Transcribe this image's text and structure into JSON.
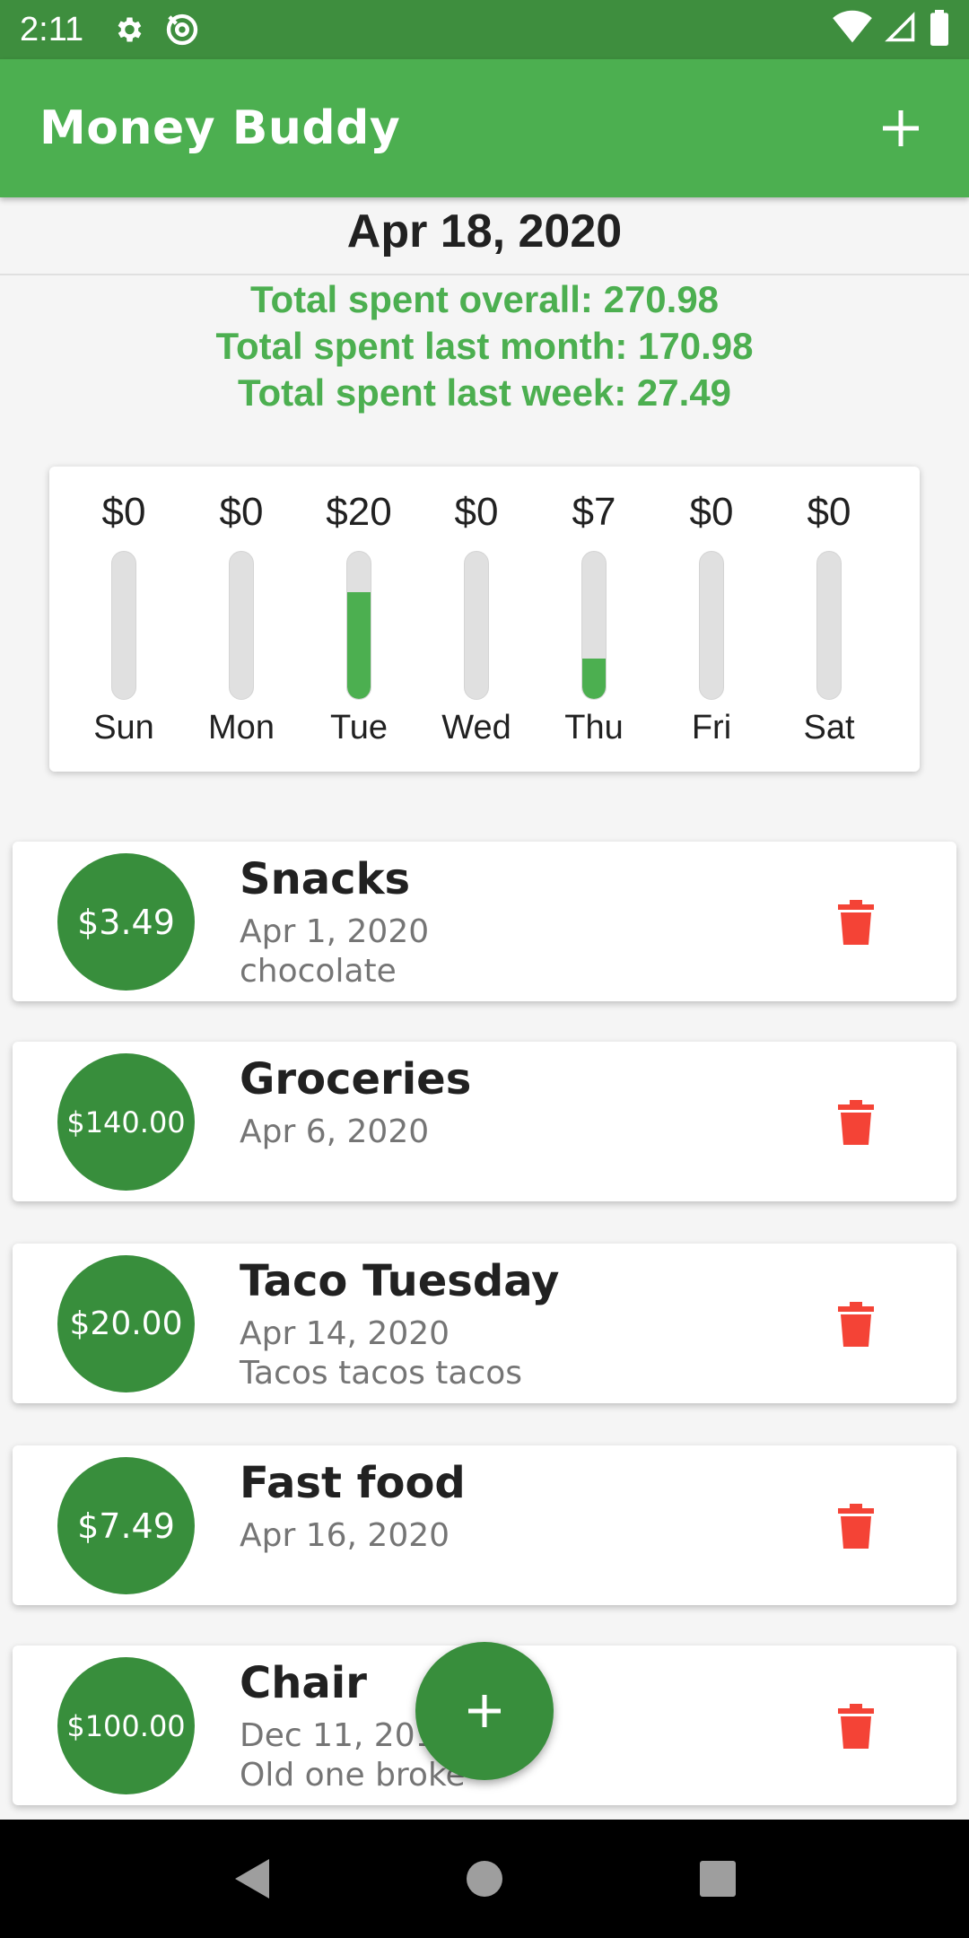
{
  "status_bar": {
    "time": "2:11"
  },
  "app_bar": {
    "title": "Money Buddy"
  },
  "date_heading": "Apr 18, 2020",
  "totals": {
    "overall": "Total spent overall: 270.98",
    "last_month": "Total spent last month: 170.98",
    "last_week": "Total spent last week: 27.49"
  },
  "chart_data": {
    "type": "bar",
    "categories": [
      "Sun",
      "Mon",
      "Tue",
      "Wed",
      "Thu",
      "Fri",
      "Sat"
    ],
    "labels": [
      "$0",
      "$0",
      "$20",
      "$0",
      "$7",
      "$0",
      "$0"
    ],
    "values": [
      0,
      0,
      20,
      0,
      7.49,
      0,
      0
    ],
    "max": 27.49
  },
  "expenses": [
    {
      "amount": "$3.49",
      "title": "Snacks",
      "date": "Apr 1, 2020",
      "note": "chocolate"
    },
    {
      "amount": "$140.00",
      "title": "Groceries",
      "date": "Apr 6, 2020",
      "note": ""
    },
    {
      "amount": "$20.00",
      "title": "Taco Tuesday",
      "date": "Apr 14, 2020",
      "note": "Tacos tacos tacos"
    },
    {
      "amount": "$7.49",
      "title": "Fast food",
      "date": "Apr 16, 2020",
      "note": ""
    },
    {
      "amount": "$100.00",
      "title": "Chair",
      "date": "Dec 11, 2019",
      "note": "Old one broke"
    }
  ],
  "colors": {
    "accent": "#4caf50",
    "dark_accent": "#388e3c",
    "delete": "#f44336"
  }
}
